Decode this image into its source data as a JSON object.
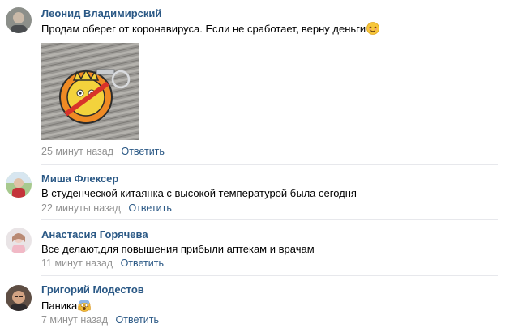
{
  "comments": [
    {
      "author": "Леонид Владимирский",
      "text": "Продам оберег от коронавируса. Если не сработает, верну деньги",
      "emoji": "smiling-face",
      "has_photo": true,
      "time": "25 минут назад",
      "reply": "Ответить"
    },
    {
      "author": "Миша Флексер",
      "text": "В студенческой китаянка с высокой температурой была сегодня",
      "time": "22 минуты назад",
      "reply": "Ответить"
    },
    {
      "author": "Анастасия Горячева",
      "text": "Все делают,для повышения прибыли аптекам и врачам",
      "time": "11 минут назад",
      "reply": "Ответить"
    },
    {
      "author": "Григорий Модестов",
      "text": "Паника",
      "emoji": "screaming-face",
      "time": "7 минут назад",
      "reply": "Ответить"
    }
  ],
  "colors": {
    "link": "#2a5885",
    "meta": "#939393",
    "divider": "#e7e8ec"
  }
}
